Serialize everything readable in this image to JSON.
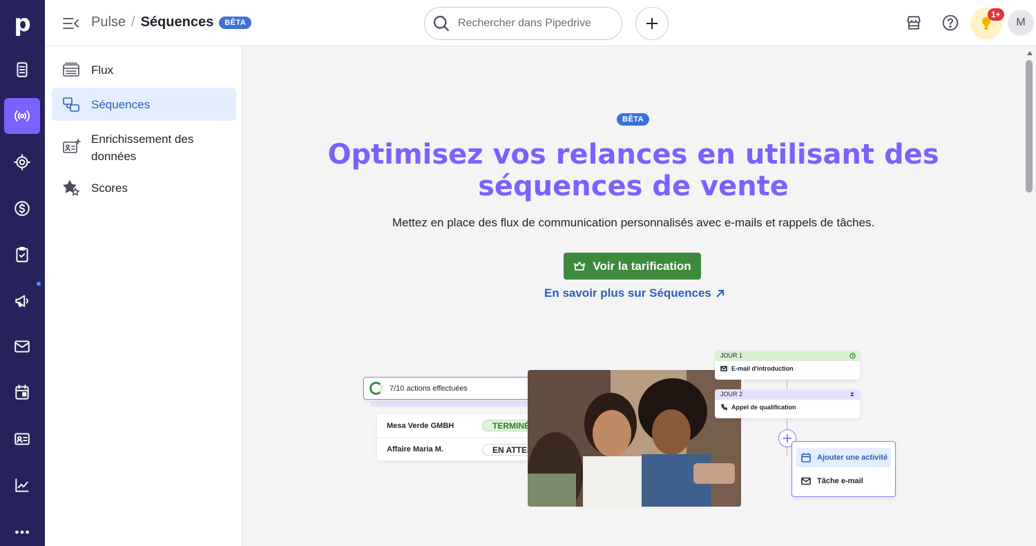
{
  "app": {
    "logo_letter": "p"
  },
  "topbar": {
    "breadcrumb_parent": "Pulse",
    "breadcrumb_separator": "/",
    "breadcrumb_current": "Séquences",
    "beta_badge": "BÊTA",
    "search_placeholder": "Rechercher dans Pipedrive",
    "notification_count": "1+",
    "avatar_initial": "M"
  },
  "rail": {
    "items": [
      {
        "icon": "leads-icon",
        "active": false
      },
      {
        "icon": "pulse-icon",
        "active": true
      },
      {
        "icon": "target-icon",
        "active": false
      },
      {
        "icon": "dollar-icon",
        "active": false
      },
      {
        "icon": "clipboard-check-icon",
        "active": false
      },
      {
        "icon": "megaphone-icon",
        "active": false
      },
      {
        "icon": "mail-icon",
        "active": false
      },
      {
        "icon": "calendar-icon",
        "active": false
      },
      {
        "icon": "contact-card-icon",
        "active": false
      },
      {
        "icon": "chart-line-icon",
        "active": false
      },
      {
        "icon": "more-icon",
        "active": false
      }
    ]
  },
  "sidenav": {
    "items": [
      {
        "label": "Flux",
        "icon": "feed-icon",
        "active": false
      },
      {
        "label": "Séquences",
        "icon": "sequences-icon",
        "active": true
      },
      {
        "label": "Enrichissement des données",
        "icon": "data-enrichment-icon",
        "active": false
      },
      {
        "label": "Scores",
        "icon": "scores-star-icon",
        "active": false
      }
    ]
  },
  "hero": {
    "badge": "BÊTA",
    "title": "Optimisez vos relances en utilisant des séquences de vente",
    "subtitle": "Mettez en place des flux de communication personnalisés avec e-mails et rappels de tâches.",
    "cta_label": "Voir la tarification",
    "learn_more": "En savoir plus sur Séquences"
  },
  "illustration": {
    "progress_label": "7/10 actions effectuées",
    "deals": [
      {
        "name": "Mesa Verde GMBH",
        "status": "TERMINÉE"
      },
      {
        "name": "Affaire Maria M.",
        "status": "EN ATTENTE"
      }
    ],
    "days": [
      {
        "day": "JOUR 1",
        "step": "E-mail d'introduction"
      },
      {
        "day": "JOUR 2",
        "step": "Appel de qualification"
      }
    ],
    "menu": {
      "add_activity": "Ajouter une activité",
      "email_task": "Tâche e-mail"
    }
  },
  "colors": {
    "rail_bg": "#26235c",
    "accent_purple": "#7b61ff",
    "link_blue": "#2c5dbd",
    "cta_green": "#3d8a3f",
    "beta_blue": "#3b72d9"
  }
}
